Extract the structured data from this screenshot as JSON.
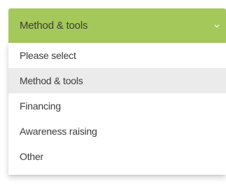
{
  "select": {
    "value": "Method & tools",
    "icon": "chevron-down-icon"
  },
  "options": [
    {
      "label": "Please select"
    },
    {
      "label": "Method & tools"
    },
    {
      "label": "Financing"
    },
    {
      "label": "Awareness raising"
    },
    {
      "label": "Other"
    }
  ],
  "colors": {
    "accent": "#a5c85a",
    "selected_bg": "#ebebeb",
    "text": "#3b3b3b"
  }
}
